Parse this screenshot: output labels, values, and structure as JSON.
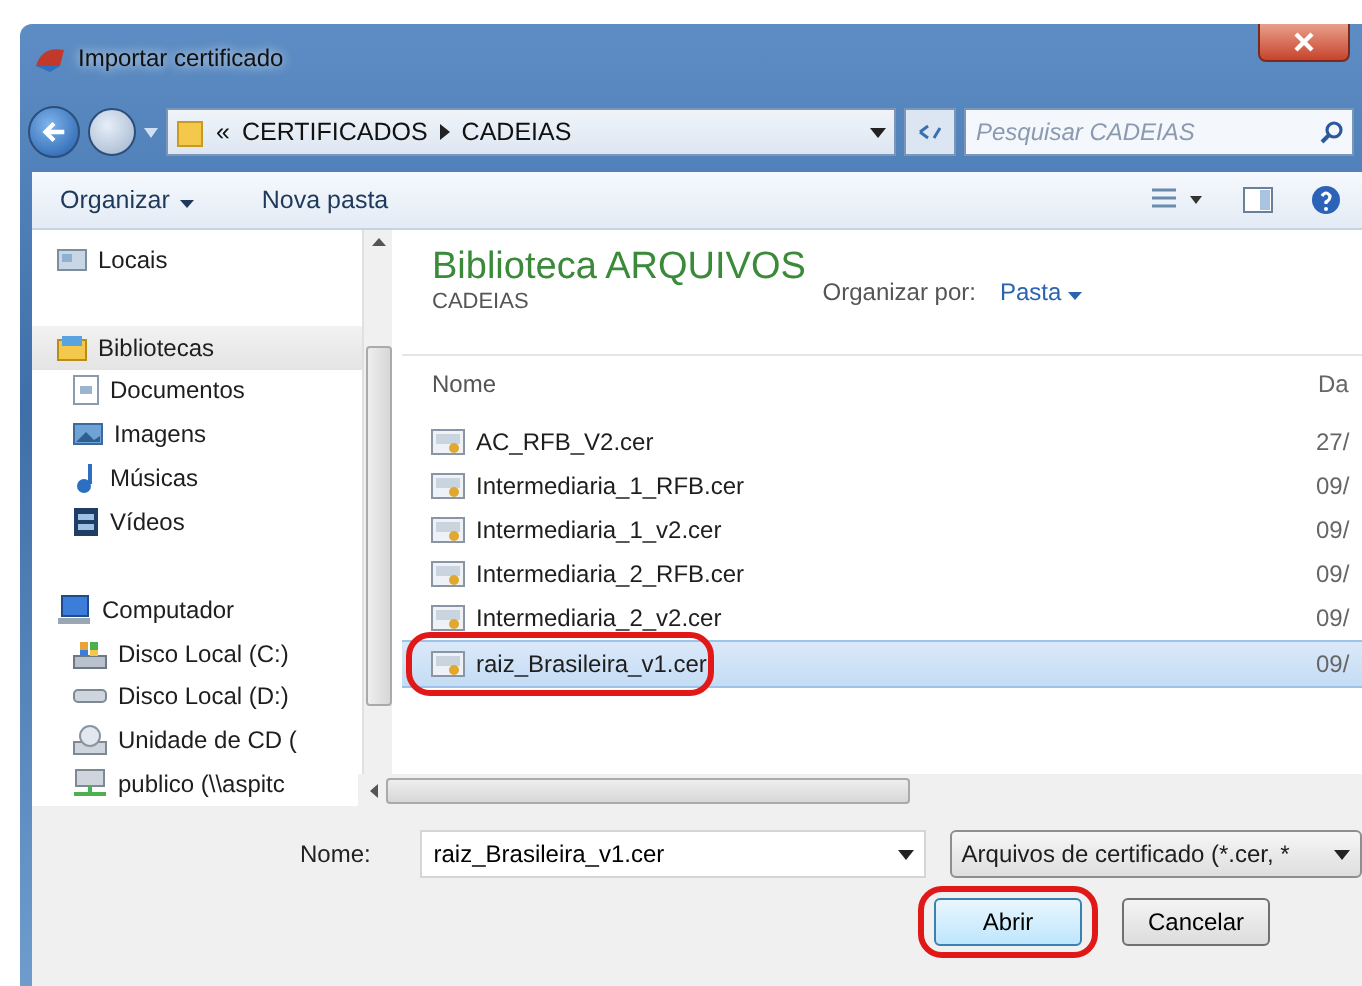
{
  "window": {
    "title": "Importar certificado"
  },
  "address_bar": {
    "overflow": "«",
    "segments": [
      "CERTIFICADOS",
      "CADEIAS"
    ]
  },
  "search": {
    "placeholder": "Pesquisar CADEIAS"
  },
  "toolbar": {
    "buttons": [
      {
        "label": "Organizar",
        "has_menu": true
      },
      {
        "label": "Nova pasta",
        "has_menu": false
      }
    ]
  },
  "sidebar": {
    "items": [
      {
        "label": "Locais",
        "kind": "places",
        "selected": false
      },
      {
        "label": "Bibliotecas",
        "kind": "library",
        "selected": true,
        "children": [
          {
            "label": "Documentos",
            "kind": "document",
            "selected": false
          },
          {
            "label": "Imagens",
            "kind": "image",
            "selected": false
          },
          {
            "label": "Músicas",
            "kind": "music",
            "selected": false
          },
          {
            "label": "Vídeos",
            "kind": "video",
            "selected": false
          }
        ]
      },
      {
        "label": "Computador",
        "kind": "computer",
        "selected": false,
        "children": [
          {
            "label": "Disco Local (C:)",
            "kind": "system-disk",
            "selected": false
          },
          {
            "label": "Disco Local (D:)",
            "kind": "disk",
            "selected": false
          },
          {
            "label": "Unidade de CD (",
            "kind": "cd",
            "selected": false
          },
          {
            "label": "publico (\\\\aspitc",
            "kind": "network",
            "selected": false
          }
        ]
      }
    ]
  },
  "library": {
    "title": "Biblioteca ARQUIVOS",
    "subtitle": "CADEIAS",
    "arrange_label": "Organizar por:",
    "arrange_value": "Pasta"
  },
  "table": {
    "columns": [
      "Nome",
      "Da"
    ],
    "rows": [
      {
        "cells": [
          "AC_RFB_V2.cer",
          "27/"
        ],
        "selected": false,
        "highlighted": false
      },
      {
        "cells": [
          "Intermediaria_1_RFB.cer",
          "09/"
        ],
        "selected": false,
        "highlighted": false
      },
      {
        "cells": [
          "Intermediaria_1_v2.cer",
          "09/"
        ],
        "selected": false,
        "highlighted": false
      },
      {
        "cells": [
          "Intermediaria_2_RFB.cer",
          "09/"
        ],
        "selected": false,
        "highlighted": false
      },
      {
        "cells": [
          "Intermediaria_2_v2.cer",
          "09/"
        ],
        "selected": false,
        "highlighted": false
      },
      {
        "cells": [
          "raiz_Brasileira_v1.cer",
          "09/"
        ],
        "selected": true,
        "highlighted": true
      }
    ]
  },
  "footer": {
    "name_label": "Nome:",
    "name_value": "raiz_Brasileira_v1.cer",
    "file_type": "Arquivos de certificado (*.cer, *",
    "buttons": [
      {
        "label": "Abrir",
        "default": true,
        "highlighted": true
      },
      {
        "label": "Cancelar",
        "default": false,
        "highlighted": false
      }
    ]
  }
}
